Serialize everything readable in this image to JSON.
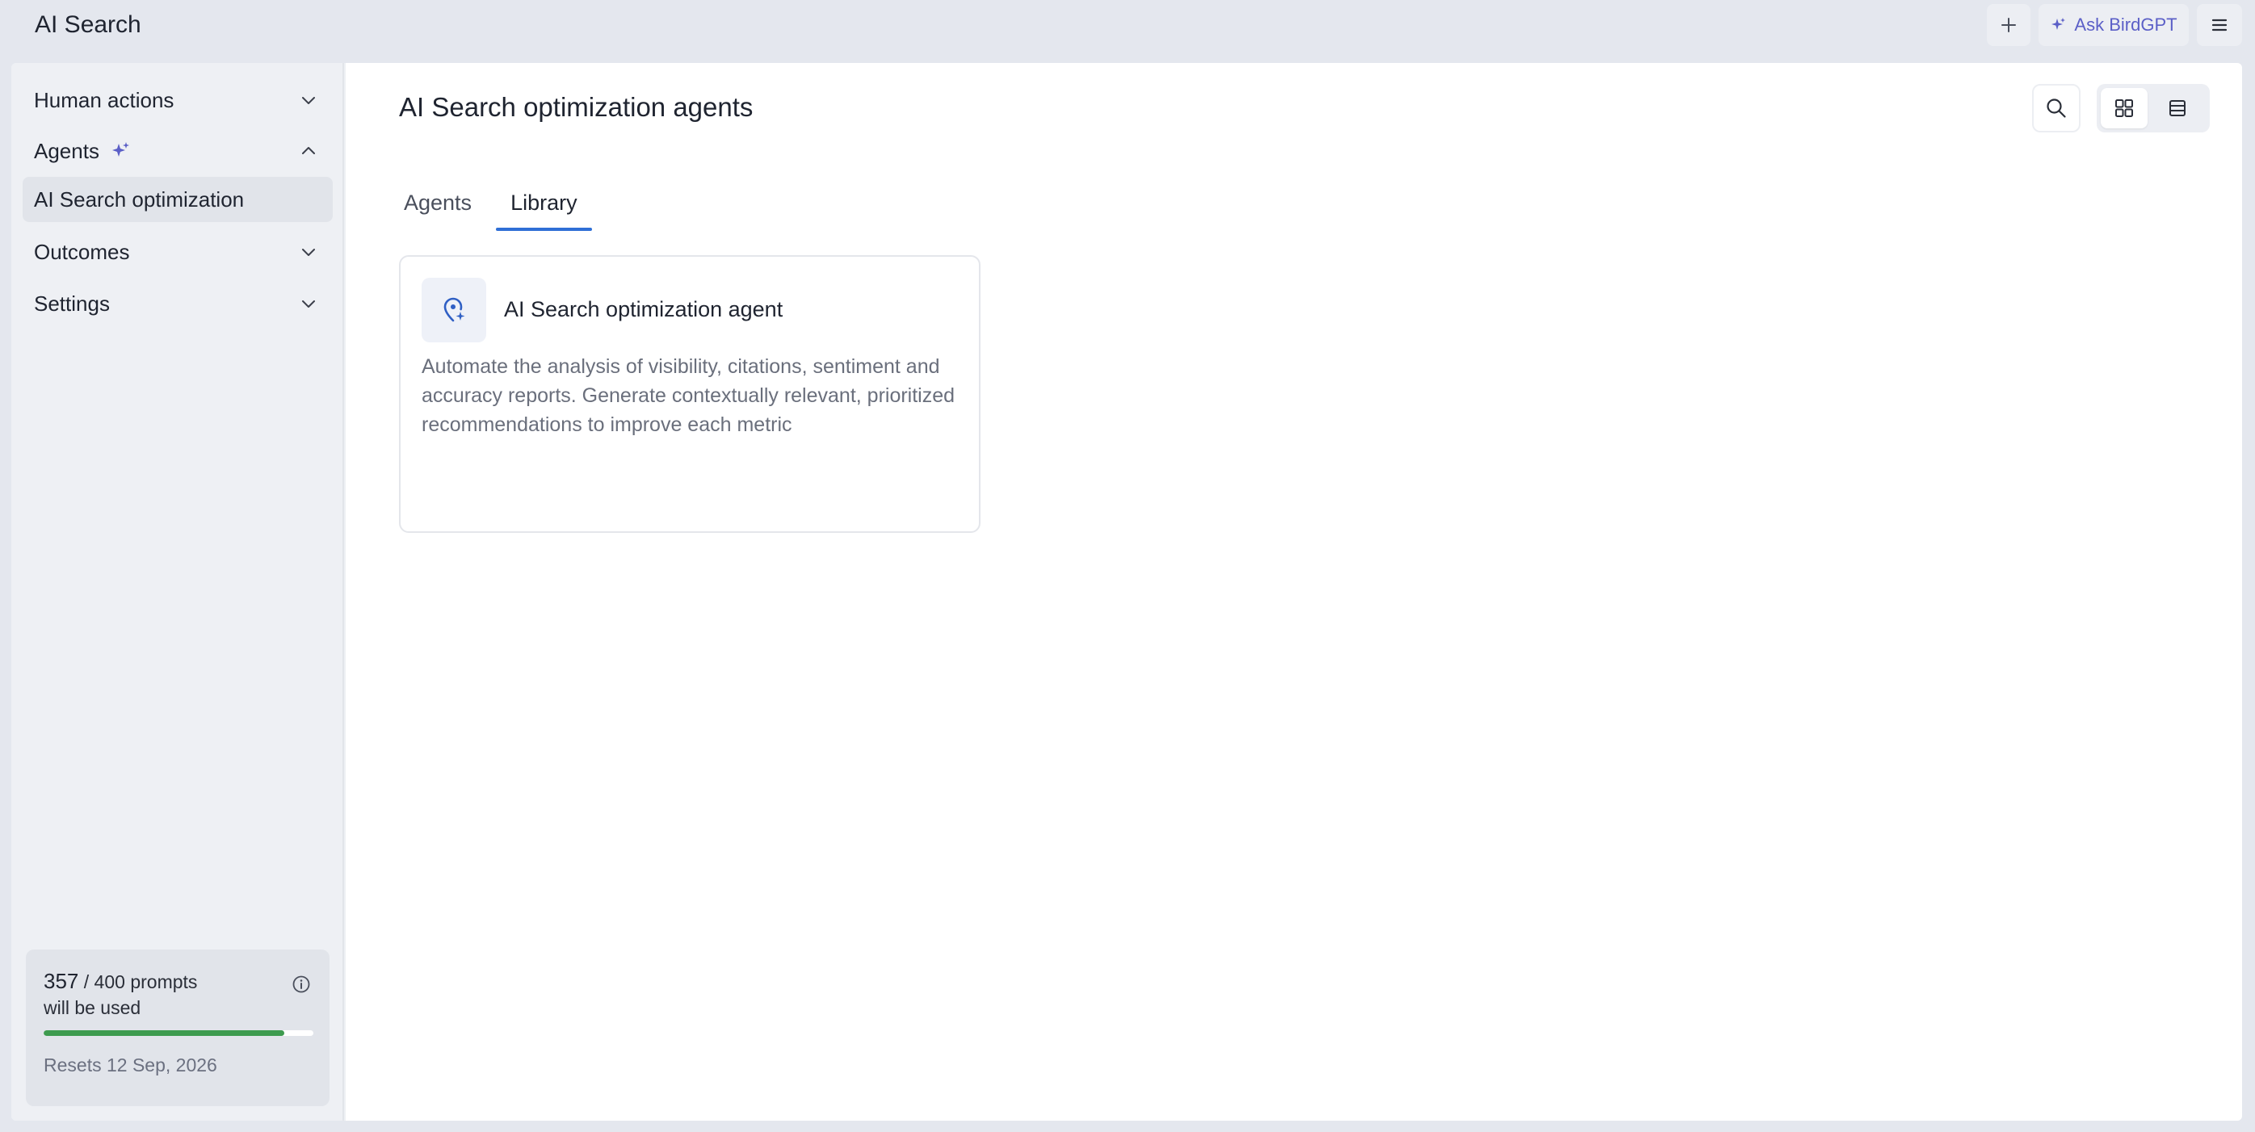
{
  "app": {
    "title": "AI Search"
  },
  "topbar": {
    "add_icon": "plus-icon",
    "ask_label": "Ask BirdGPT",
    "ask_icon": "sparkle-icon",
    "menu_icon": "hamburger-menu-icon"
  },
  "sidebar": {
    "items": [
      {
        "label": "Human actions",
        "icon": "chevron-down-icon"
      },
      {
        "label": "Agents",
        "icon": "chevron-up-icon",
        "badge_icon": "sparkle-icon"
      },
      {
        "label": "AI Search optimization",
        "active": true
      },
      {
        "label": "Outcomes",
        "icon": "chevron-down-icon"
      },
      {
        "label": "Settings",
        "icon": "chevron-down-icon"
      }
    ],
    "usage": {
      "used": "357",
      "total_text": "/ 400 prompts",
      "subtext": "will be used",
      "progress_fraction": 0.8925,
      "resets": "Resets 12 Sep, 2026",
      "accent": "#3e9b4f"
    }
  },
  "main": {
    "title": "AI Search optimization agents",
    "tabs": [
      {
        "label": "Agents",
        "active": false
      },
      {
        "label": "Library",
        "active": true
      }
    ],
    "view_mode": "grid",
    "cards": [
      {
        "title": "AI Search optimization agent",
        "description": "Automate the analysis of visibility, citations, sentiment and accuracy reports. Generate contextually relevant, prioritized recommendations to improve each metric",
        "icon": "location-pin-sparkle-icon"
      }
    ]
  },
  "colors": {
    "accent_blue": "#2f6fd6",
    "ask_purple": "#5b5fc7"
  }
}
